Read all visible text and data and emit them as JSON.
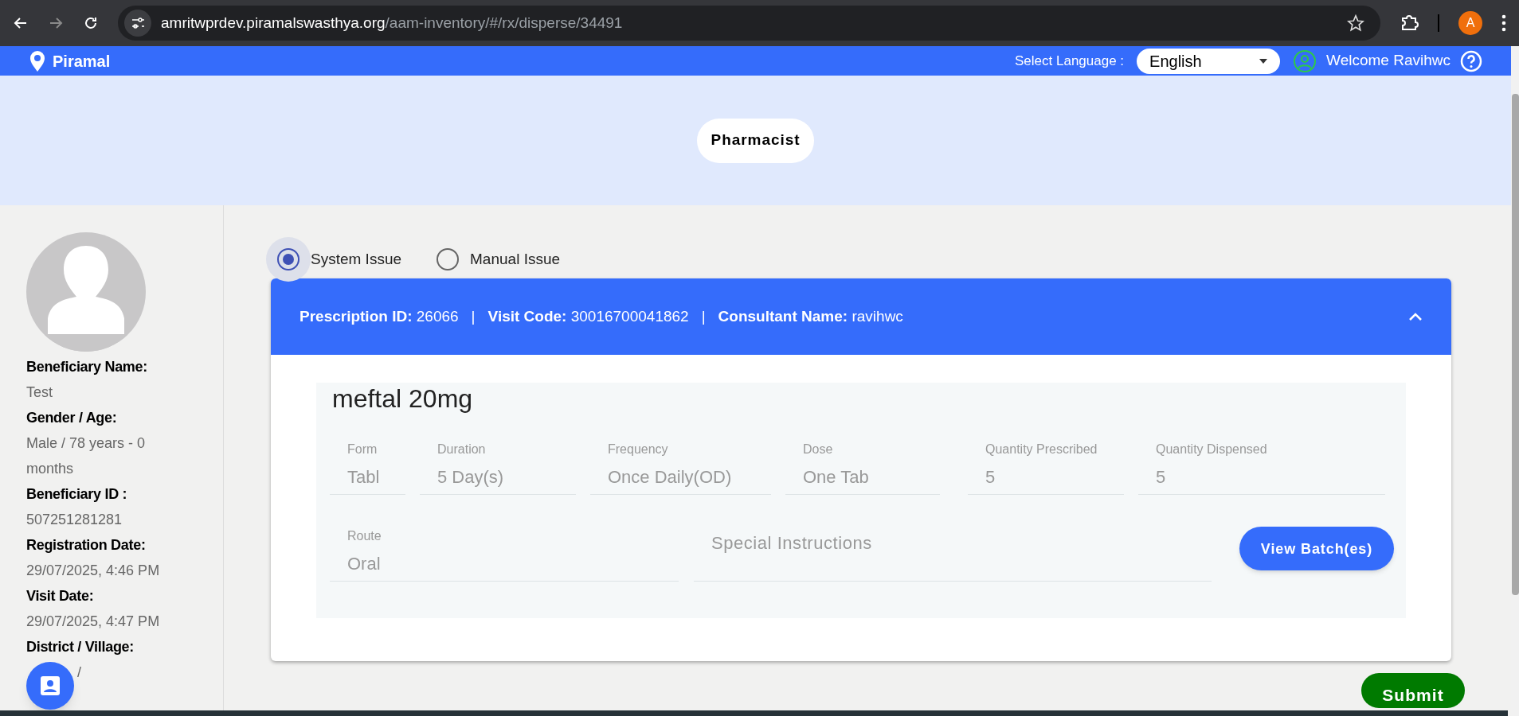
{
  "browser": {
    "url_host": "amritwprdev.piramalswasthya.org",
    "url_path": "/aam-inventory/#/rx/disperse/34491",
    "profile_letter": "A"
  },
  "header": {
    "logo_text": "Piramal",
    "language_label": "Select Language :",
    "language": "English",
    "welcome": "Welcome Ravihwc"
  },
  "role": "Pharmacist",
  "beneficiary": [
    {
      "label": "Beneficiary Name:",
      "value": "Test"
    },
    {
      "label": "Gender / Age:",
      "value": "Male / 78 years - 0 months",
      "kind": "plain"
    },
    {
      "label": "Beneficiary ID :",
      "value": "507251281281"
    },
    {
      "label": "Registration Date:",
      "value": "29/07/2025, 4:46 PM"
    },
    {
      "label": "Visit Date:",
      "value": "29/07/2025, 4:47 PM"
    },
    {
      "label": "District / Village:",
      "value": "/",
      "kind": "covered"
    }
  ],
  "issue_options": [
    {
      "label": "System Issue",
      "selected": true
    },
    {
      "label": "Manual Issue",
      "selected": false
    }
  ],
  "prescription": {
    "expanded": true,
    "parts": [
      {
        "label": "Prescription ID:",
        "value": "26066"
      },
      {
        "label": "Visit Code:",
        "value": "30016700041862"
      },
      {
        "label": "Consultant Name:",
        "value": "ravihwc"
      }
    ],
    "separator": "|"
  },
  "medicine": {
    "name": "meftal 20mg",
    "fields": [
      {
        "label": "Form",
        "value": "Tabl"
      },
      {
        "label": "Duration",
        "value": "5 Day(s)"
      },
      {
        "label": "Frequency",
        "value": "Once Daily(OD)"
      },
      {
        "label": "Dose",
        "value": "One Tab"
      },
      {
        "label": "Quantity Prescribed",
        "value": "5"
      },
      {
        "label": "Quantity Dispensed",
        "value": "5"
      }
    ],
    "route": {
      "label": "Route",
      "value": "Oral"
    },
    "special_instructions": {
      "placeholder": "Special Instructions"
    },
    "view_button": "View Batch(es)"
  },
  "submit": "Submit"
}
